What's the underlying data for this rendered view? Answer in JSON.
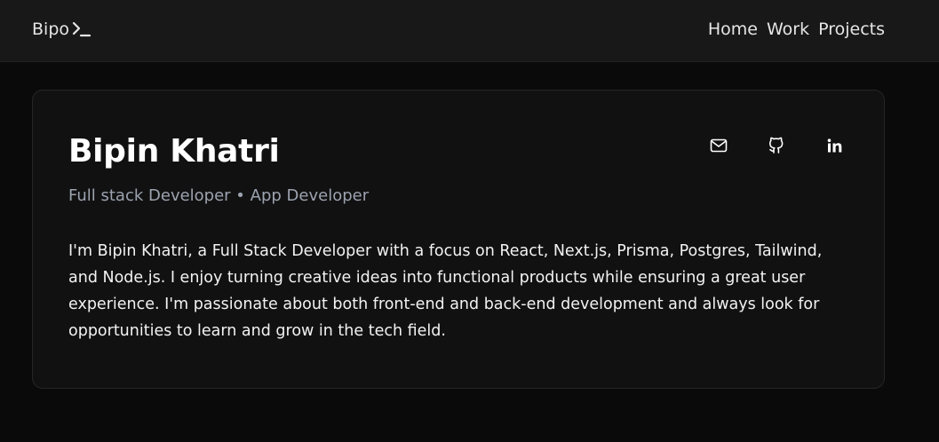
{
  "header": {
    "brand": "Bipo",
    "nav": [
      {
        "label": "Home"
      },
      {
        "label": "Work"
      },
      {
        "label": "Projects"
      }
    ]
  },
  "profile": {
    "name": "Bipin Khatri",
    "roles": "Full stack Developer • App Developer",
    "bio": "I'm Bipin Khatri, a Full Stack Developer with a focus on React, Next.js, Prisma, Postgres, Tailwind, and Node.js. I enjoy turning creative ideas into functional products while ensuring a great user experience. I'm passionate about both front-end and back-end development and always look for opportunities to learn and grow in the tech field.",
    "socials": [
      {
        "icon": "mail-icon"
      },
      {
        "icon": "github-icon"
      },
      {
        "icon": "linkedin-icon"
      }
    ]
  },
  "colors": {
    "background": "#0a0a0a",
    "navbar": "#181818",
    "card": "#111111",
    "muted_text": "#9ca3af"
  }
}
